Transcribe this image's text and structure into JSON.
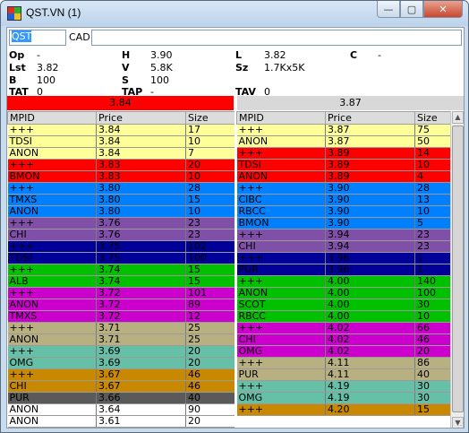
{
  "window": {
    "title": "QST.VN (1)",
    "buttons": {
      "minimize": "—",
      "maximize": "▢",
      "close": "✕"
    }
  },
  "symbol": {
    "value": "QST",
    "currency": "CAD"
  },
  "quote": {
    "op_label": "Op",
    "op_value": "-",
    "h_label": "H",
    "h_value": "3.90",
    "l_label": "L",
    "l_value": "3.82",
    "c_label": "C",
    "c_value": "-",
    "lst_label": "Lst",
    "lst_value": "3.82",
    "v_label": "V",
    "v_value": "5.8K",
    "sz_label": "Sz",
    "sz_value": "1.7Kx5K",
    "b_label": "B",
    "b_value": "100",
    "s_label": "S",
    "s_value": "100",
    "tat_label": "TAT",
    "tat_value": "0",
    "tap_label": "TAP",
    "tap_value": "-",
    "tav_label": "TAV",
    "tav_value": "0"
  },
  "bbo": {
    "bid": "3.84",
    "ask": "3.87"
  },
  "columns": {
    "mpid": "MPID",
    "price": "Price",
    "size": "Size"
  },
  "colors": {
    "yellow": "#ffff99",
    "red": "#ff0000",
    "blue": "#0080ff",
    "purple": "#8050a8",
    "navy": "#000099",
    "green": "#00c000",
    "magenta": "#cc00cc",
    "khaki": "#b8b080",
    "teal": "#66c0a8",
    "orange": "#c88800",
    "gray": "#5a5a5a",
    "white": "#ffffff"
  },
  "bid_rows": [
    {
      "mpid": "+++",
      "price": "3.84",
      "size": "17",
      "color": "yellow"
    },
    {
      "mpid": "TDSI",
      "price": "3.84",
      "size": "10",
      "color": "yellow"
    },
    {
      "mpid": "ANON",
      "price": "3.84",
      "size": "7",
      "color": "yellow"
    },
    {
      "mpid": "+++",
      "price": "3.83",
      "size": "20",
      "color": "red"
    },
    {
      "mpid": "BMON",
      "price": "3.83",
      "size": "10",
      "color": "red"
    },
    {
      "mpid": "+++",
      "price": "3.80",
      "size": "28",
      "color": "blue"
    },
    {
      "mpid": "TMXS",
      "price": "3.80",
      "size": "15",
      "color": "blue"
    },
    {
      "mpid": "ANON",
      "price": "3.80",
      "size": "10",
      "color": "blue"
    },
    {
      "mpid": "+++",
      "price": "3.76",
      "size": "23",
      "color": "purple"
    },
    {
      "mpid": "CHI",
      "price": "3.76",
      "size": "23",
      "color": "purple"
    },
    {
      "mpid": "+++",
      "price": "3.75",
      "size": "102",
      "color": "navy"
    },
    {
      "mpid": "TDSI",
      "price": "3.75",
      "size": "100",
      "color": "navy"
    },
    {
      "mpid": "+++",
      "price": "3.74",
      "size": "15",
      "color": "green"
    },
    {
      "mpid": "ALB",
      "price": "3.74",
      "size": "15",
      "color": "green"
    },
    {
      "mpid": "+++",
      "price": "3.72",
      "size": "101",
      "color": "magenta"
    },
    {
      "mpid": "ANON",
      "price": "3.72",
      "size": "89",
      "color": "magenta"
    },
    {
      "mpid": "TMXS",
      "price": "3.72",
      "size": "12",
      "color": "magenta"
    },
    {
      "mpid": "+++",
      "price": "3.71",
      "size": "25",
      "color": "khaki"
    },
    {
      "mpid": "ANON",
      "price": "3.71",
      "size": "25",
      "color": "khaki"
    },
    {
      "mpid": "+++",
      "price": "3.69",
      "size": "20",
      "color": "teal"
    },
    {
      "mpid": "OMG",
      "price": "3.69",
      "size": "20",
      "color": "teal"
    },
    {
      "mpid": "+++",
      "price": "3.67",
      "size": "46",
      "color": "orange"
    },
    {
      "mpid": "CHI",
      "price": "3.67",
      "size": "46",
      "color": "orange"
    },
    {
      "mpid": "PUR",
      "price": "3.66",
      "size": "40",
      "color": "gray"
    },
    {
      "mpid": "ANON",
      "price": "3.64",
      "size": "90",
      "color": "white"
    },
    {
      "mpid": "ANON",
      "price": "3.61",
      "size": "20",
      "color": "white"
    }
  ],
  "ask_rows": [
    {
      "mpid": "+++",
      "price": "3.87",
      "size": "75",
      "color": "yellow"
    },
    {
      "mpid": "ANON",
      "price": "3.87",
      "size": "50",
      "color": "yellow"
    },
    {
      "mpid": "+++",
      "price": "3.89",
      "size": "14",
      "color": "red"
    },
    {
      "mpid": "TDSI",
      "price": "3.89",
      "size": "10",
      "color": "red"
    },
    {
      "mpid": "ANON",
      "price": "3.89",
      "size": "4",
      "color": "red"
    },
    {
      "mpid": "+++",
      "price": "3.90",
      "size": "28",
      "color": "blue"
    },
    {
      "mpid": "CIBC",
      "price": "3.90",
      "size": "13",
      "color": "blue"
    },
    {
      "mpid": "RBCC",
      "price": "3.90",
      "size": "10",
      "color": "blue"
    },
    {
      "mpid": "BMON",
      "price": "3.90",
      "size": "5",
      "color": "blue"
    },
    {
      "mpid": "+++",
      "price": "3.94",
      "size": "23",
      "color": "purple"
    },
    {
      "mpid": "CHI",
      "price": "3.94",
      "size": "23",
      "color": "purple"
    },
    {
      "mpid": "+++",
      "price": "3.96",
      "size": "1",
      "color": "navy"
    },
    {
      "mpid": "PUR",
      "price": "3.96",
      "size": "1",
      "color": "navy"
    },
    {
      "mpid": "+++",
      "price": "4.00",
      "size": "140",
      "color": "green"
    },
    {
      "mpid": "ANON",
      "price": "4.00",
      "size": "100",
      "color": "green"
    },
    {
      "mpid": "SCOT",
      "price": "4.00",
      "size": "30",
      "color": "green"
    },
    {
      "mpid": "RBCC",
      "price": "4.00",
      "size": "10",
      "color": "green"
    },
    {
      "mpid": "+++",
      "price": "4.02",
      "size": "66",
      "color": "magenta"
    },
    {
      "mpid": "CHI",
      "price": "4.02",
      "size": "46",
      "color": "magenta"
    },
    {
      "mpid": "OMG",
      "price": "4.02",
      "size": "20",
      "color": "magenta"
    },
    {
      "mpid": "+++",
      "price": "4.11",
      "size": "86",
      "color": "khaki"
    },
    {
      "mpid": "PUR",
      "price": "4.11",
      "size": "40",
      "color": "khaki"
    },
    {
      "mpid": "+++",
      "price": "4.19",
      "size": "30",
      "color": "teal"
    },
    {
      "mpid": "OMG",
      "price": "4.19",
      "size": "30",
      "color": "teal"
    },
    {
      "mpid": "+++",
      "price": "4.20",
      "size": "15",
      "color": "orange"
    }
  ]
}
